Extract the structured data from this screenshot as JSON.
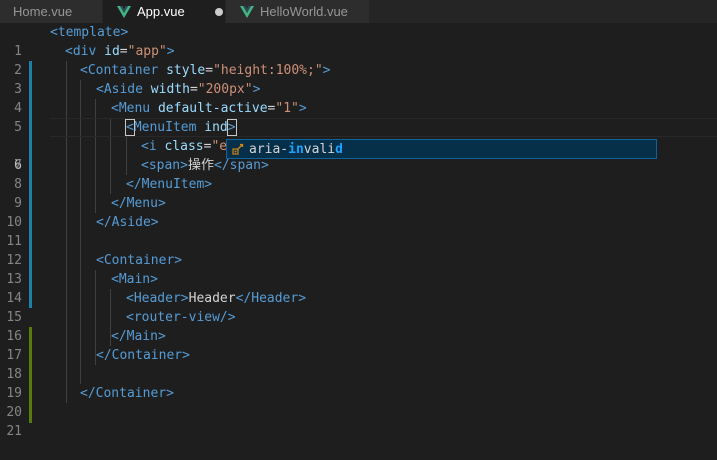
{
  "tabs": [
    {
      "label": "Home.vue",
      "active": false
    },
    {
      "label": "App.vue",
      "active": true,
      "modified": true
    },
    {
      "label": "HelloWorld.vue",
      "active": false
    }
  ],
  "colors": {
    "tag": "#569cd6",
    "attribute": "#9cdcfe",
    "string": "#ce9178",
    "text": "#d4d4d4",
    "vue_green": "#41b883",
    "gutter_modified": "#1b81a8",
    "gutter_added": "#587c0c"
  },
  "editor": {
    "current_line": 6,
    "line_numbers": [
      "1",
      "2",
      "3",
      "4",
      "5",
      "6",
      "7",
      "8",
      "9",
      "10",
      "11",
      "12",
      "13",
      "14",
      "15",
      "16",
      "17",
      "18",
      "19",
      "20",
      "21"
    ]
  },
  "code": {
    "l1_tag": "<template>",
    "l2_open": "<div",
    "l2_attr": "id",
    "l2_val": "\"app\"",
    "l2_close": ">",
    "l3_open": "<Container",
    "l3_attr": "style",
    "l3_val": "\"height:100%;\"",
    "l3_close": ">",
    "l4_open": "<Aside",
    "l4_attr": "width",
    "l4_val": "\"200px\"",
    "l4_close": ">",
    "l5_open": "<Menu",
    "l5_attr": "default-active",
    "l5_val": "\"1\"",
    "l5_close": ">",
    "l6_lt": "<",
    "l6_name": "MenuItem",
    "l6_attr": "ind",
    "l6_gt": ">",
    "l7_open": "<i",
    "l7_attr": "class",
    "l7_val": "\"e",
    "l8_open": "<span>",
    "l8_text": "操作",
    "l8_close": "</span>",
    "l9_tag": "</MenuItem>",
    "l10_tag": "</Menu>",
    "l11_tag": "</Aside>",
    "l13_tag": "<Container>",
    "l14_tag": "<Main>",
    "l15_open": "<Header>",
    "l15_text": "Header",
    "l15_close": "</Header>",
    "l16_tag": "<router-view/>",
    "l17_tag": "</Main>",
    "l18_tag": "</Container>",
    "l20_tag": "</Container>"
  },
  "suggestion": {
    "icon": "wrench-property-icon",
    "pre": "aria-",
    "match1": "in",
    "mid": "vali",
    "match2": "d"
  }
}
